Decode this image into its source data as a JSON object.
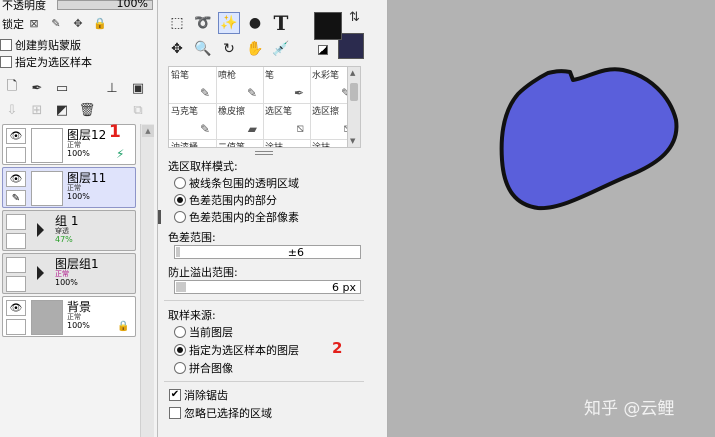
{
  "layers_panel": {
    "opacity_label": "不透明度",
    "opacity_value": "100%",
    "lock_label": "锁定",
    "clip_label": "创建剪贴蒙版",
    "sample_label": "指定为选区样本",
    "layers": [
      {
        "name": "图层12",
        "mode": "正常",
        "opacity": "100%",
        "mark": "1"
      },
      {
        "name": "图层11",
        "mode": "正常",
        "opacity": "100%"
      },
      {
        "name": "组 1",
        "mode": "穿透",
        "opacity": "47%"
      },
      {
        "name": "图层组1",
        "mode": "正常",
        "opacity": "100%"
      },
      {
        "name": "背景",
        "mode": "正常",
        "opacity": "100%"
      }
    ],
    "colors": {
      "group_opacity": "#2aa02a",
      "group_mode": "#b0128a",
      "mark": "#e3201b"
    }
  },
  "tool_panel": {
    "brushes": [
      {
        "name": "铅笔",
        "icon": "pencil-icon"
      },
      {
        "name": "喷枪",
        "icon": "airbrush-icon"
      },
      {
        "name": "笔",
        "icon": "pen-icon"
      },
      {
        "name": "水彩笔",
        "icon": "watercolor-icon"
      },
      {
        "name": "马克笔",
        "icon": "marker-icon"
      },
      {
        "name": "橡皮擦",
        "icon": "eraser-icon"
      },
      {
        "name": "选区笔",
        "icon": "selpen-icon"
      },
      {
        "name": "选区擦",
        "icon": "selerase-icon"
      },
      {
        "name": "油漆桶",
        "icon": "bucket-icon"
      },
      {
        "name": "二值笔",
        "icon": "binary-pen-icon"
      },
      {
        "name": "涂抹",
        "icon": "smudge-icon"
      },
      {
        "name": "涂抹",
        "icon": "smudge2-icon"
      }
    ],
    "select_mode_label": "选区取样模式:",
    "select_modes": [
      {
        "label": "被线条包围的透明区域",
        "checked": false
      },
      {
        "label": "色差范围内的部分",
        "checked": true
      },
      {
        "label": "色差范围内的全部像素",
        "checked": false
      }
    ],
    "tolerance_label": "色差范围:",
    "tolerance_value": "±6",
    "overflow_label": "防止溢出范围:",
    "overflow_value": "6 px",
    "source_label": "取样来源:",
    "sources": [
      {
        "label": "当前图层",
        "checked": false
      },
      {
        "label": "指定为选区样本的图层",
        "checked": true,
        "mark": "2"
      },
      {
        "label": "拼合图像",
        "checked": false
      }
    ],
    "antialias_label": "消除锯齿",
    "antialias_checked": true,
    "ignore_label": "忽略已选择的区域",
    "ignore_checked": false,
    "colors": {
      "main": "#121212",
      "sub": "#2b2b4e"
    }
  },
  "canvas": {
    "background": "#b3b3b3",
    "blob_fill": "#5a5fdb",
    "blob_stroke": "#111111",
    "watermark": "知乎 @云鲤"
  }
}
